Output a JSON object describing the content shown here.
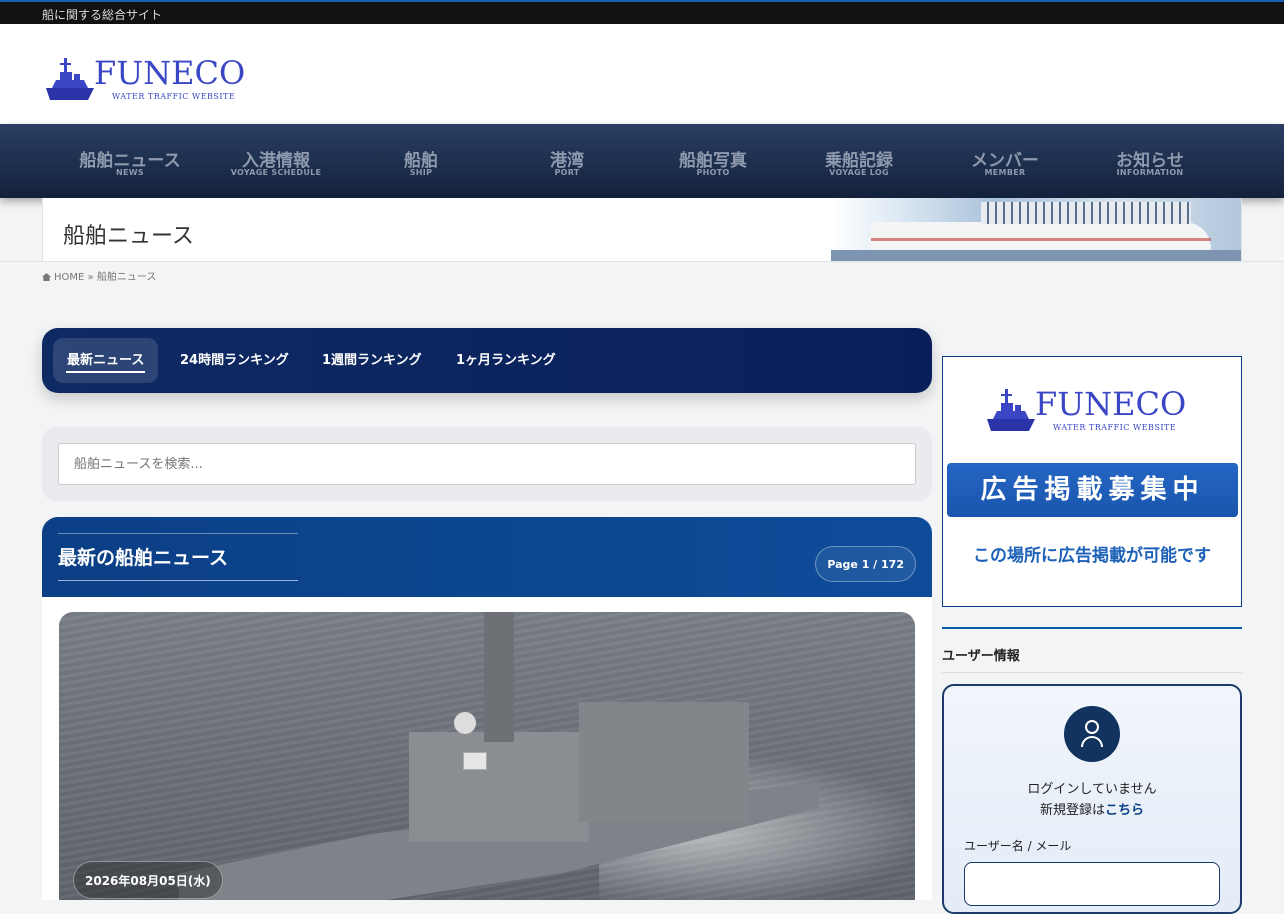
{
  "topbar": {
    "tagline": "船に関する総合サイト"
  },
  "logo": {
    "name": "FUNECO",
    "sub": "WATER TRAFFIC WEBSITE"
  },
  "nav": [
    {
      "jp": "船舶ニュース",
      "en": "NEWS"
    },
    {
      "jp": "入港情報",
      "en": "VOYAGE SCHEDULE"
    },
    {
      "jp": "船舶",
      "en": "SHIP"
    },
    {
      "jp": "港湾",
      "en": "PORT"
    },
    {
      "jp": "船舶写真",
      "en": "PHOTO"
    },
    {
      "jp": "乗船記録",
      "en": "VOYAGE LOG"
    },
    {
      "jp": "メンバー",
      "en": "MEMBER"
    },
    {
      "jp": "お知らせ",
      "en": "INFORMATION"
    }
  ],
  "page": {
    "title": "船舶ニュース"
  },
  "breadcrumb": {
    "home": "HOME",
    "sep": "»",
    "current": "船舶ニュース"
  },
  "tabs": [
    {
      "label": "最新ニュース",
      "active": true
    },
    {
      "label": "24時間ランキング",
      "active": false
    },
    {
      "label": "1週間ランキング",
      "active": false
    },
    {
      "label": "1ヶ月ランキング",
      "active": false
    }
  ],
  "search": {
    "placeholder": "船舶ニュースを検索..."
  },
  "news": {
    "heading": "最新の船舶ニュース",
    "page_indicator": "Page 1 / 172",
    "featured": {
      "date": "2026年08月05日(水)",
      "image": "destroyer-at-sea"
    }
  },
  "sidebar": {
    "ad": {
      "banner": "広告掲載募集中",
      "text": "この場所に広告掲載が可能です"
    },
    "user_heading": "ユーザー情報",
    "user": {
      "status": "ログインしていません",
      "register_prefix": "新規登録は",
      "register_link": "こちら",
      "field_label": "ユーザー名 / メール"
    }
  },
  "colors": {
    "nav_bg": "#1c2e4d",
    "accent": "#0a3f86",
    "logo": "#3a46c4"
  }
}
